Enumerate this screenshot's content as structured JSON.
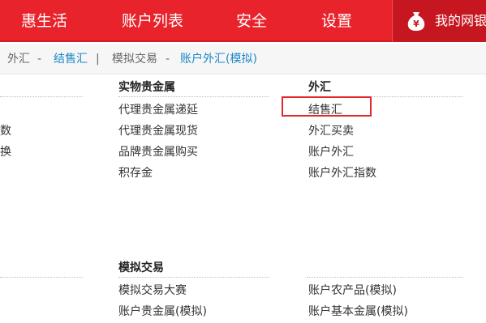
{
  "nav": {
    "items": [
      "惠生活",
      "账户列表",
      "安全",
      "设置"
    ],
    "bank_label": "我的网银"
  },
  "breadcrumb": {
    "part1": "外汇",
    "sep1": "-",
    "part2": "结售汇",
    "divider": "|",
    "part3": "模拟交易",
    "sep2": "-",
    "part4": "账户外汇(模拟)"
  },
  "left_partial": {
    "row1": "数",
    "row2": "换"
  },
  "sections": {
    "precious_metals": {
      "heading": "实物贵金属",
      "items": [
        "代理贵金属递延",
        "代理贵金属现货",
        "品牌贵金属购买",
        "积存金"
      ]
    },
    "forex": {
      "heading": "外汇",
      "items": [
        "结售汇",
        "外汇买卖",
        "账户外汇",
        "账户外汇指数"
      ]
    },
    "simulation": {
      "heading": "模拟交易",
      "left_items": [
        "模拟交易大赛",
        "账户贵金属(模拟)"
      ],
      "right_items": [
        "账户农产品(模拟)",
        "账户基本金属(模拟)"
      ]
    }
  },
  "colors": {
    "brand_red": "#e8232c",
    "link_blue": "#1a87c8",
    "highlight_red": "#e5282e"
  },
  "icons": {
    "bank": "money-bag-icon"
  }
}
